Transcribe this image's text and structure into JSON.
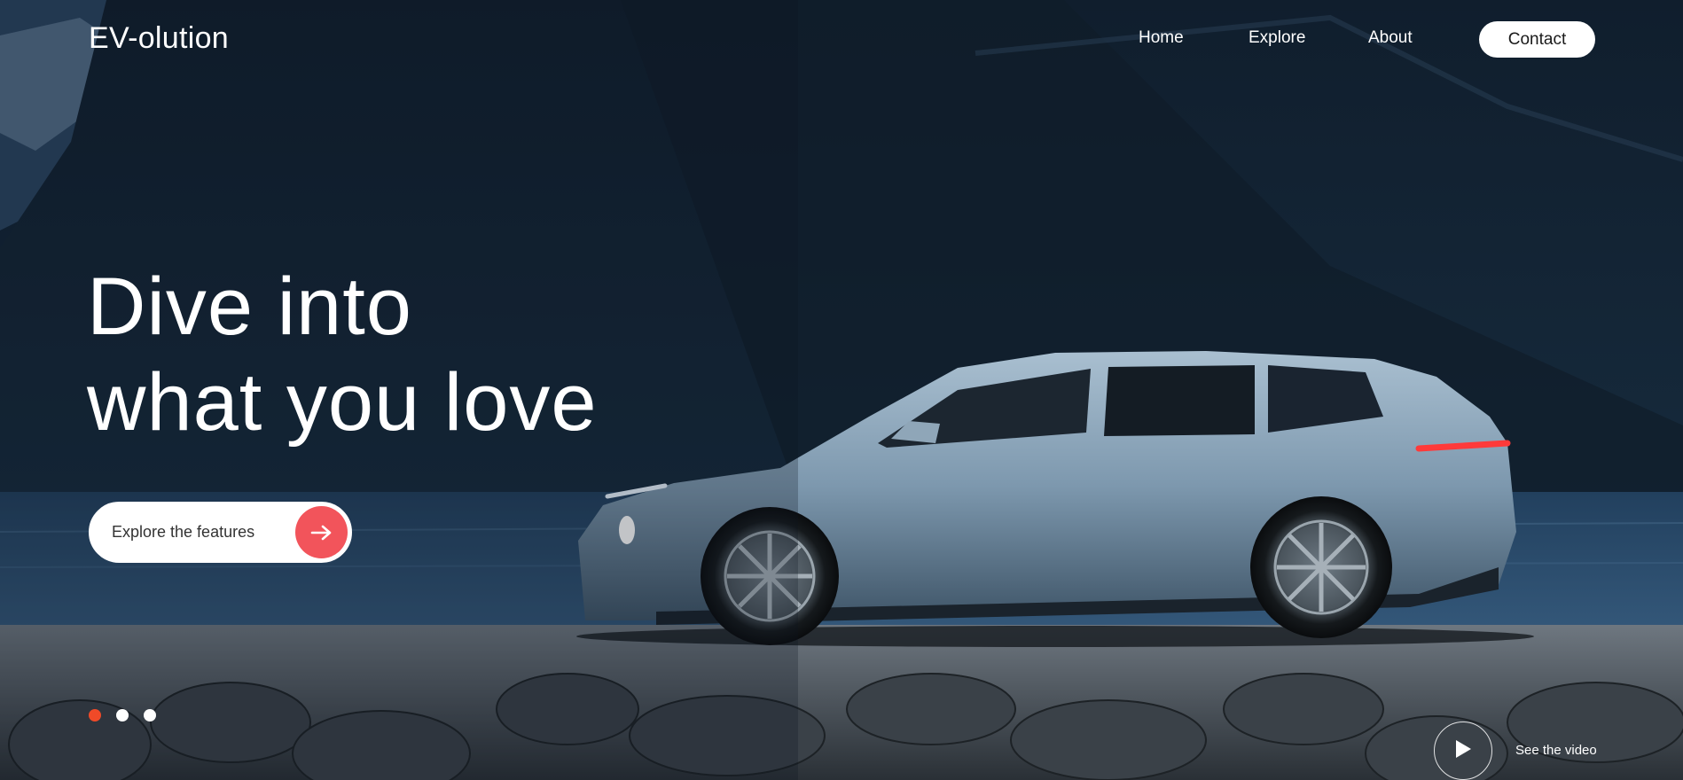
{
  "header": {
    "logo": "EV-olution",
    "nav": {
      "home": "Home",
      "explore": "Explore",
      "about": "About",
      "contact": "Contact"
    }
  },
  "hero": {
    "headline_line1": "Dive into",
    "headline_line2": "what you love",
    "cta_label": "Explore the features",
    "cta_icon": "arrow-right-icon",
    "video_label": "See the video",
    "video_icon": "play-icon"
  },
  "slider": {
    "total": 3,
    "active_index": 0
  },
  "colors": {
    "accent": "#f2545b",
    "active_dot": "#f04a28",
    "text": "#ffffff",
    "button_bg": "#ffffff",
    "button_text": "#1a1a1a"
  }
}
